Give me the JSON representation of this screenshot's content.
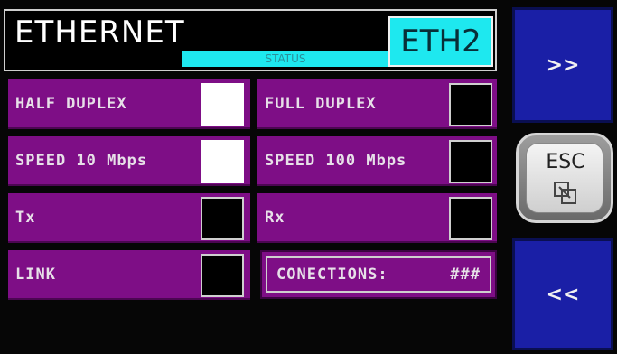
{
  "header": {
    "title": "ETHERNET",
    "status_label": "STATUS",
    "interface_badge": "ETH2"
  },
  "left_rows": [
    {
      "label": "HALF DUPLEX",
      "checked": true
    },
    {
      "label": "SPEED 10 Mbps",
      "checked": true
    },
    {
      "label": "Tx",
      "checked": false
    },
    {
      "label": "LINK",
      "checked": false
    }
  ],
  "right_rows": [
    {
      "label": "FULL DUPLEX",
      "checked": false
    },
    {
      "label": "SPEED 100 Mbps",
      "checked": false
    },
    {
      "label": "Rx",
      "checked": false
    }
  ],
  "connections": {
    "label": "CONECTIONS:",
    "value": "###"
  },
  "nav": {
    "next_label": ">>",
    "esc_label": "ESC",
    "esc_icon": "window-swap-icon",
    "prev_label": "<<"
  },
  "colors": {
    "row_purple": "#7e0e86",
    "accent_cyan": "#1ee8ef",
    "nav_blue": "#1a1fa6"
  }
}
